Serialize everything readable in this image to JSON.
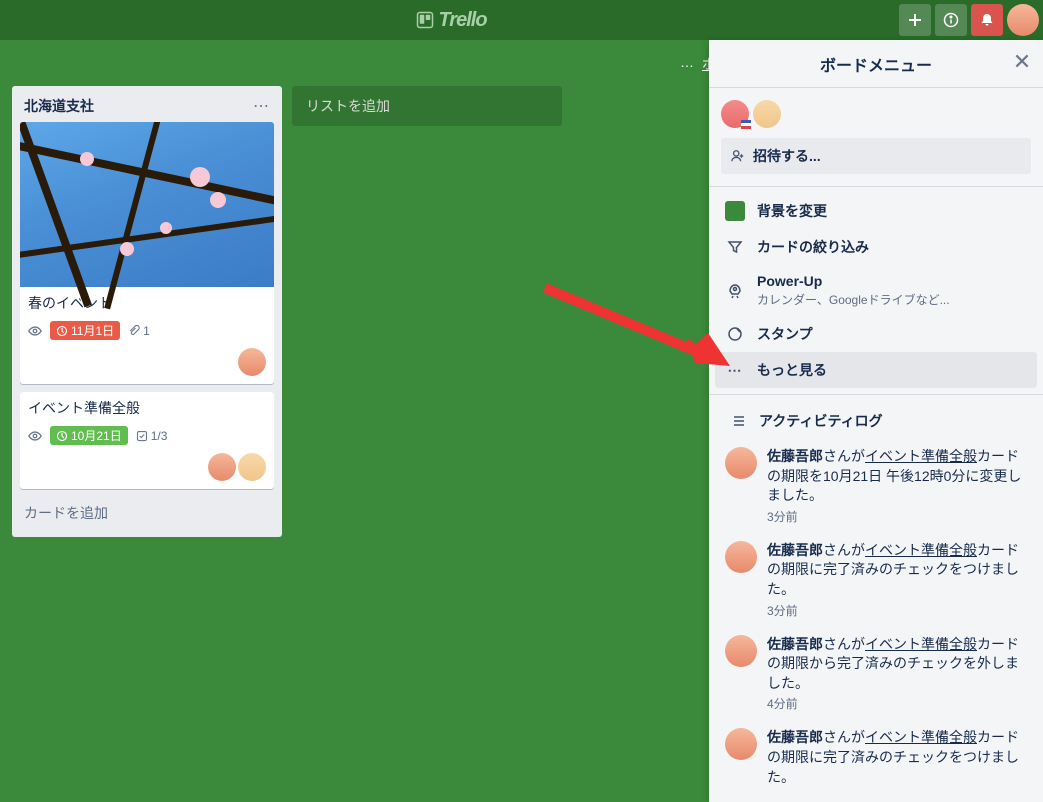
{
  "header": {
    "logo_text": "Trello"
  },
  "board_top": {
    "link_text": "ボ"
  },
  "list": {
    "title": "北海道支社",
    "add_card": "カードを追加",
    "cards": [
      {
        "title": "春のイベント",
        "due": "11月1日",
        "attach": "1"
      },
      {
        "title": "イベント準備全般",
        "due": "10月21日",
        "check": "1/3"
      }
    ]
  },
  "add_list": "リストを追加",
  "menu": {
    "title": "ボードメニュー",
    "invite": "招待する...",
    "items": {
      "bg": "背景を変更",
      "filter": "カードの絞り込み",
      "powerup": "Power-Up",
      "powerup_sub": "カレンダー、Googleドライブなど...",
      "stickers": "スタンプ",
      "more": "もっと見る"
    },
    "activity_title": "アクティビティログ",
    "activities": [
      {
        "user": "佐藤吾郎",
        "mid": "さんが",
        "link": "イベント準備全般",
        "rest": "カードの期限を10月21日 午後12時0分に変更しました。",
        "time": "3分前"
      },
      {
        "user": "佐藤吾郎",
        "mid": "さんが",
        "link": "イベント準備全般",
        "rest": "カードの期限に完了済みのチェックをつけました。",
        "time": "3分前"
      },
      {
        "user": "佐藤吾郎",
        "mid": "さんが",
        "link": "イベント準備全般",
        "rest": "カードの期限から完了済みのチェックを外しました。",
        "time": "4分前"
      },
      {
        "user": "佐藤吾郎",
        "mid": "さんが",
        "link": "イベント準備全般",
        "rest": "カードの期限に完了済みのチェックをつけました。",
        "time": ""
      }
    ]
  }
}
